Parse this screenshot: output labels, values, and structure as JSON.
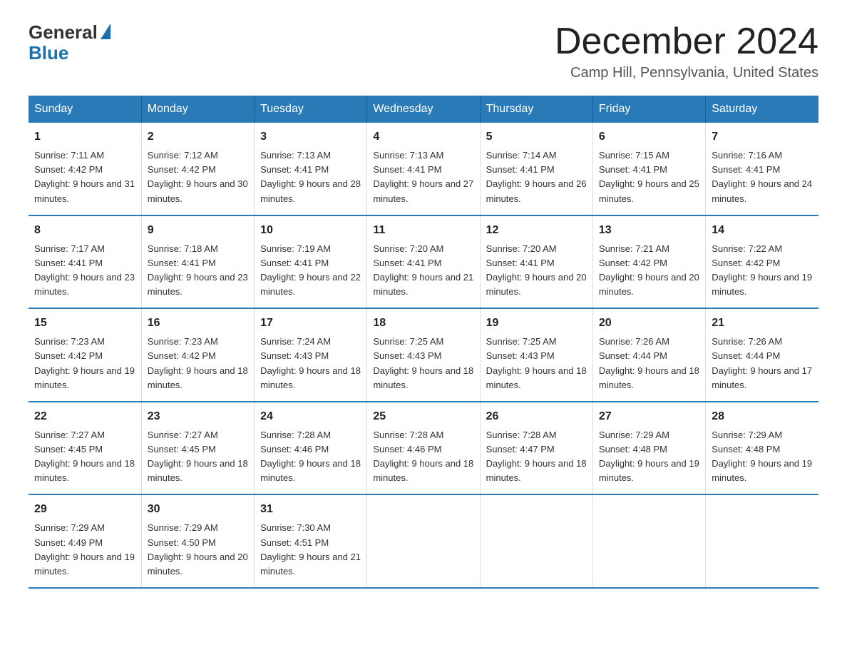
{
  "header": {
    "logo_general": "General",
    "logo_blue": "Blue",
    "month_title": "December 2024",
    "location": "Camp Hill, Pennsylvania, United States"
  },
  "days_of_week": [
    "Sunday",
    "Monday",
    "Tuesday",
    "Wednesday",
    "Thursday",
    "Friday",
    "Saturday"
  ],
  "weeks": [
    [
      {
        "date": "1",
        "sunrise": "7:11 AM",
        "sunset": "4:42 PM",
        "daylight": "9 hours and 31 minutes."
      },
      {
        "date": "2",
        "sunrise": "7:12 AM",
        "sunset": "4:42 PM",
        "daylight": "9 hours and 30 minutes."
      },
      {
        "date": "3",
        "sunrise": "7:13 AM",
        "sunset": "4:41 PM",
        "daylight": "9 hours and 28 minutes."
      },
      {
        "date": "4",
        "sunrise": "7:13 AM",
        "sunset": "4:41 PM",
        "daylight": "9 hours and 27 minutes."
      },
      {
        "date": "5",
        "sunrise": "7:14 AM",
        "sunset": "4:41 PM",
        "daylight": "9 hours and 26 minutes."
      },
      {
        "date": "6",
        "sunrise": "7:15 AM",
        "sunset": "4:41 PM",
        "daylight": "9 hours and 25 minutes."
      },
      {
        "date": "7",
        "sunrise": "7:16 AM",
        "sunset": "4:41 PM",
        "daylight": "9 hours and 24 minutes."
      }
    ],
    [
      {
        "date": "8",
        "sunrise": "7:17 AM",
        "sunset": "4:41 PM",
        "daylight": "9 hours and 23 minutes."
      },
      {
        "date": "9",
        "sunrise": "7:18 AM",
        "sunset": "4:41 PM",
        "daylight": "9 hours and 23 minutes."
      },
      {
        "date": "10",
        "sunrise": "7:19 AM",
        "sunset": "4:41 PM",
        "daylight": "9 hours and 22 minutes."
      },
      {
        "date": "11",
        "sunrise": "7:20 AM",
        "sunset": "4:41 PM",
        "daylight": "9 hours and 21 minutes."
      },
      {
        "date": "12",
        "sunrise": "7:20 AM",
        "sunset": "4:41 PM",
        "daylight": "9 hours and 20 minutes."
      },
      {
        "date": "13",
        "sunrise": "7:21 AM",
        "sunset": "4:42 PM",
        "daylight": "9 hours and 20 minutes."
      },
      {
        "date": "14",
        "sunrise": "7:22 AM",
        "sunset": "4:42 PM",
        "daylight": "9 hours and 19 minutes."
      }
    ],
    [
      {
        "date": "15",
        "sunrise": "7:23 AM",
        "sunset": "4:42 PM",
        "daylight": "9 hours and 19 minutes."
      },
      {
        "date": "16",
        "sunrise": "7:23 AM",
        "sunset": "4:42 PM",
        "daylight": "9 hours and 18 minutes."
      },
      {
        "date": "17",
        "sunrise": "7:24 AM",
        "sunset": "4:43 PM",
        "daylight": "9 hours and 18 minutes."
      },
      {
        "date": "18",
        "sunrise": "7:25 AM",
        "sunset": "4:43 PM",
        "daylight": "9 hours and 18 minutes."
      },
      {
        "date": "19",
        "sunrise": "7:25 AM",
        "sunset": "4:43 PM",
        "daylight": "9 hours and 18 minutes."
      },
      {
        "date": "20",
        "sunrise": "7:26 AM",
        "sunset": "4:44 PM",
        "daylight": "9 hours and 18 minutes."
      },
      {
        "date": "21",
        "sunrise": "7:26 AM",
        "sunset": "4:44 PM",
        "daylight": "9 hours and 17 minutes."
      }
    ],
    [
      {
        "date": "22",
        "sunrise": "7:27 AM",
        "sunset": "4:45 PM",
        "daylight": "9 hours and 18 minutes."
      },
      {
        "date": "23",
        "sunrise": "7:27 AM",
        "sunset": "4:45 PM",
        "daylight": "9 hours and 18 minutes."
      },
      {
        "date": "24",
        "sunrise": "7:28 AM",
        "sunset": "4:46 PM",
        "daylight": "9 hours and 18 minutes."
      },
      {
        "date": "25",
        "sunrise": "7:28 AM",
        "sunset": "4:46 PM",
        "daylight": "9 hours and 18 minutes."
      },
      {
        "date": "26",
        "sunrise": "7:28 AM",
        "sunset": "4:47 PM",
        "daylight": "9 hours and 18 minutes."
      },
      {
        "date": "27",
        "sunrise": "7:29 AM",
        "sunset": "4:48 PM",
        "daylight": "9 hours and 19 minutes."
      },
      {
        "date": "28",
        "sunrise": "7:29 AM",
        "sunset": "4:48 PM",
        "daylight": "9 hours and 19 minutes."
      }
    ],
    [
      {
        "date": "29",
        "sunrise": "7:29 AM",
        "sunset": "4:49 PM",
        "daylight": "9 hours and 19 minutes."
      },
      {
        "date": "30",
        "sunrise": "7:29 AM",
        "sunset": "4:50 PM",
        "daylight": "9 hours and 20 minutes."
      },
      {
        "date": "31",
        "sunrise": "7:30 AM",
        "sunset": "4:51 PM",
        "daylight": "9 hours and 21 minutes."
      },
      {
        "date": "",
        "sunrise": "",
        "sunset": "",
        "daylight": ""
      },
      {
        "date": "",
        "sunrise": "",
        "sunset": "",
        "daylight": ""
      },
      {
        "date": "",
        "sunrise": "",
        "sunset": "",
        "daylight": ""
      },
      {
        "date": "",
        "sunrise": "",
        "sunset": "",
        "daylight": ""
      }
    ]
  ],
  "labels": {
    "sunrise_prefix": "Sunrise: ",
    "sunset_prefix": "Sunset: ",
    "daylight_prefix": "Daylight: "
  }
}
